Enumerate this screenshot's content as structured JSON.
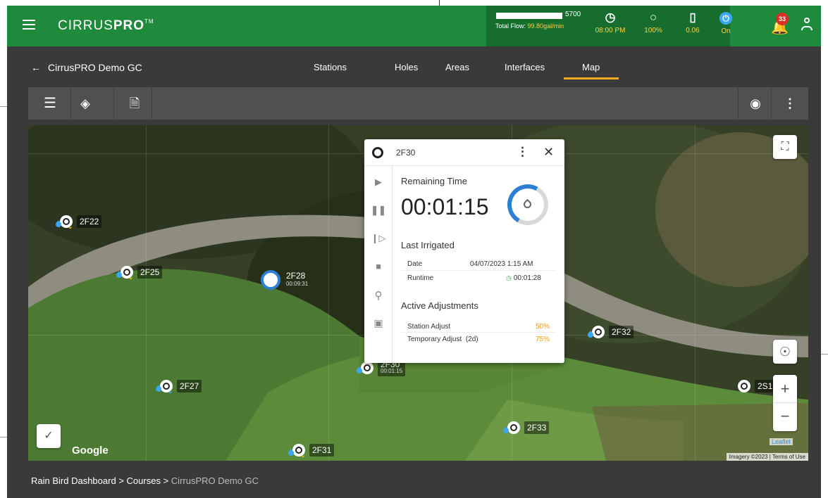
{
  "app": {
    "logo_left": "CIRRUS",
    "logo_right": "PRO",
    "logo_tm": "TM"
  },
  "header": {
    "flow_max": "5700",
    "flow_label": "Total Flow:",
    "flow_value": "99.80",
    "flow_unit": "gal/min",
    "flow_fraction": 0.0175,
    "stats": [
      {
        "icon": "clock-icon",
        "glyph": "◷",
        "value": "08:00 PM"
      },
      {
        "icon": "water-drop-icon",
        "glyph": "○",
        "value": "100%"
      },
      {
        "icon": "gauge-icon",
        "glyph": "▯",
        "value": "0.06"
      },
      {
        "icon": "power-icon",
        "glyph": "⏻",
        "value": "On"
      }
    ],
    "notification_count": "33"
  },
  "nav": {
    "back_label": "CirrusPRO Demo GC",
    "tabs": [
      "Stations",
      "Holes",
      "Areas",
      "Interfaces",
      "Map"
    ],
    "active_tab": "Map"
  },
  "map": {
    "google_label": "Google",
    "leaflet_label": "Leaflet",
    "imagery_label": "Imagery ©2023",
    "terms_label": "Terms of Use",
    "markers": [
      {
        "label": "2F22"
      },
      {
        "label": "2F25"
      },
      {
        "label": "2F28",
        "sub": "00:09:31"
      },
      {
        "label": "2F27"
      },
      {
        "label": "2F31"
      },
      {
        "label": "2F33"
      },
      {
        "label": "2F32"
      },
      {
        "label": "2S1"
      },
      {
        "label": "2F30",
        "sub": "00:01:15"
      }
    ],
    "zoom_in": "+",
    "zoom_out": "−"
  },
  "popup": {
    "title": "2F30",
    "remaining_label": "Remaining Time",
    "remaining_time": "00:01:15",
    "last_irrigated_label": "Last Irrigated",
    "date_label": "Date",
    "date_value": "04/07/2023 1:15 AM",
    "runtime_label": "Runtime",
    "runtime_value": "00:01:28",
    "active_label": "Active Adjustments",
    "station_adjust_label": "Station Adjust",
    "station_adjust_value": "50%",
    "temp_adjust_label": "Temporary Adjust",
    "temp_adjust_days": "(2d)",
    "temp_adjust_value": "75%"
  },
  "footer": {
    "crumbs": [
      "Rain Bird Dashboard",
      "Courses",
      "CirrusPRO Demo GC"
    ],
    "separator": ">"
  }
}
